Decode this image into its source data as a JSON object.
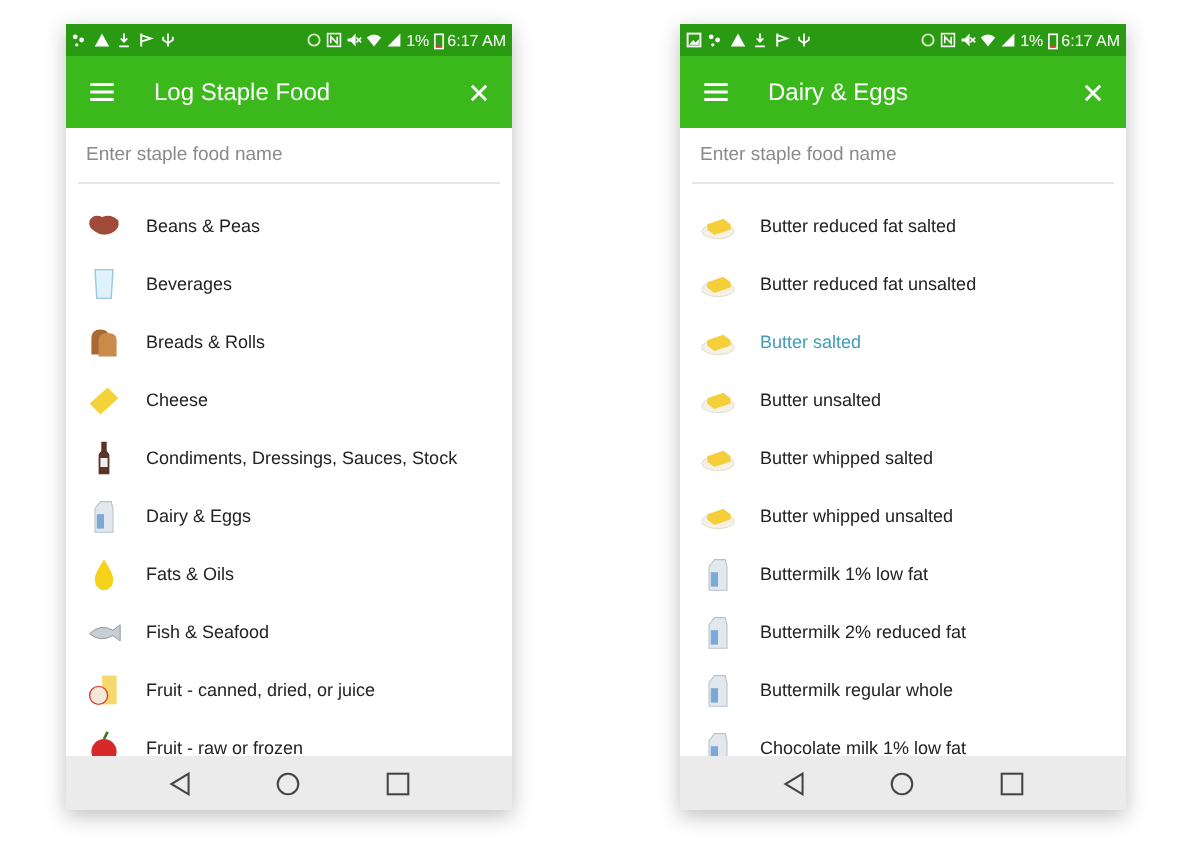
{
  "screens": [
    {
      "status_bar": {
        "battery": "1%",
        "time": "6:17 AM",
        "notification_image": false
      },
      "app_bar": {
        "title": "Log Staple Food"
      },
      "search": {
        "placeholder": "Enter staple food name"
      },
      "items": [
        {
          "label": "Beans & Peas",
          "kind": "beans",
          "selected": false
        },
        {
          "label": "Beverages",
          "kind": "glass",
          "selected": false
        },
        {
          "label": "Breads & Rolls",
          "kind": "bread",
          "selected": false
        },
        {
          "label": "Cheese",
          "kind": "cheese",
          "selected": false
        },
        {
          "label": "Condiments, Dressings, Sauces, Stock",
          "kind": "bottle",
          "selected": false
        },
        {
          "label": "Dairy & Eggs",
          "kind": "milk",
          "selected": false
        },
        {
          "label": "Fats & Oils",
          "kind": "drop",
          "selected": false
        },
        {
          "label": "Fish & Seafood",
          "kind": "fish",
          "selected": false
        },
        {
          "label": "Fruit - canned, dried, or juice",
          "kind": "juice",
          "selected": false
        },
        {
          "label": "Fruit - raw or frozen",
          "kind": "apple",
          "selected": false
        }
      ]
    },
    {
      "status_bar": {
        "battery": "1%",
        "time": "6:17 AM",
        "notification_image": true
      },
      "app_bar": {
        "title": "Dairy & Eggs"
      },
      "search": {
        "placeholder": "Enter staple food name"
      },
      "items": [
        {
          "label": "Butter reduced fat salted",
          "kind": "butter",
          "selected": false
        },
        {
          "label": "Butter reduced fat unsalted",
          "kind": "butter",
          "selected": false
        },
        {
          "label": "Butter salted",
          "kind": "butter",
          "selected": true
        },
        {
          "label": "Butter unsalted",
          "kind": "butter",
          "selected": false
        },
        {
          "label": "Butter whipped salted",
          "kind": "butter",
          "selected": false
        },
        {
          "label": "Butter whipped unsalted",
          "kind": "butter",
          "selected": false
        },
        {
          "label": "Buttermilk 1% low fat",
          "kind": "milk",
          "selected": false
        },
        {
          "label": "Buttermilk 2% reduced fat",
          "kind": "milk",
          "selected": false
        },
        {
          "label": "Buttermilk regular whole",
          "kind": "milk",
          "selected": false
        },
        {
          "label": "Chocolate milk 1% low fat",
          "kind": "milk",
          "selected": false
        }
      ]
    }
  ]
}
